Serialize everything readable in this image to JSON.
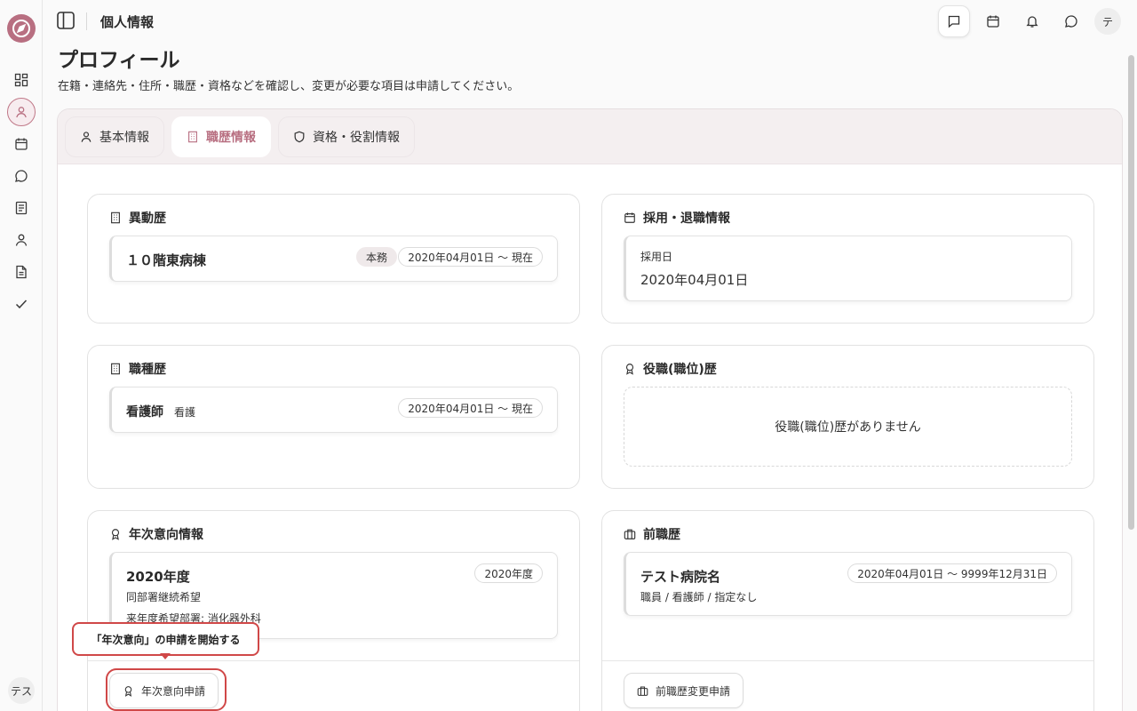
{
  "header": {
    "title": "個人情報",
    "avatar": "テ"
  },
  "sidebar": {
    "avatar": "テス"
  },
  "page": {
    "heading": "プロフィール",
    "description": "在籍・連絡先・住所・職歴・資格などを確認し、変更が必要な項目は申請してください。"
  },
  "tabs": [
    {
      "label": "基本情報"
    },
    {
      "label": "職歴情報"
    },
    {
      "label": "資格・役割情報"
    }
  ],
  "transfer": {
    "title": "異動歴",
    "item": {
      "name": "１０階東病棟",
      "badge": "本務",
      "period": "2020年04月01日 〜 現在"
    }
  },
  "hiring": {
    "title": "採用・退職情報",
    "label": "採用日",
    "value": "2020年04月01日"
  },
  "job_type": {
    "title": "職種歴",
    "item": {
      "name": "看護師",
      "sub": "看護",
      "period": "2020年04月01日 〜 現在"
    }
  },
  "position": {
    "title": "役職(職位)歴",
    "empty": "役職(職位)歴がありません"
  },
  "annual": {
    "title": "年次意向情報",
    "item": {
      "year": "2020年度",
      "badge": "2020年度",
      "line1": "同部署継続希望",
      "line2": "来年度希望部署: 消化器外科"
    },
    "button": "年次意向申請"
  },
  "previous": {
    "title": "前職歴",
    "item": {
      "name": "テスト病院名",
      "period": "2020年04月01日 〜 9999年12月31日",
      "detail": "職員 / 看護師 / 指定なし"
    },
    "button": "前職歴変更申請"
  },
  "tooltip": "「年次意向」の申請を開始する"
}
